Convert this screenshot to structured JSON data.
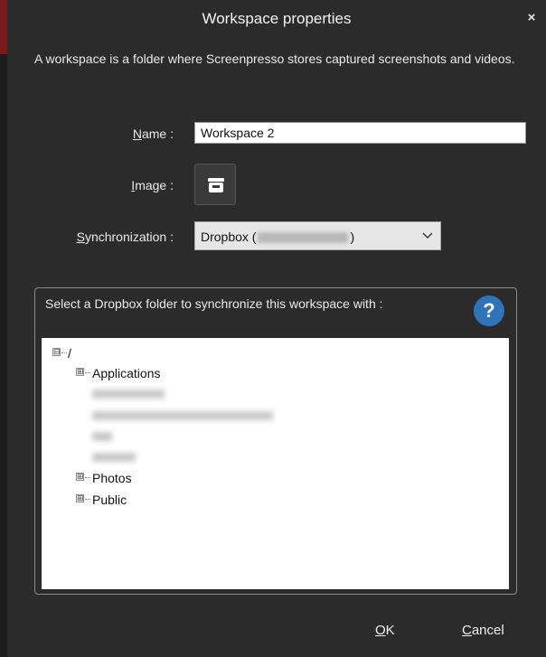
{
  "window": {
    "title": "Workspace properties",
    "close_glyph": "×"
  },
  "description": "A workspace is a folder where Screenpresso stores captured screenshots and videos.",
  "form": {
    "name_label": {
      "mnemonic": "N",
      "rest": "ame :"
    },
    "name_value": "Workspace 2",
    "image_label": {
      "mnemonic": "I",
      "rest": "mage :"
    },
    "image_icon": "tray-icon",
    "sync_label": {
      "mnemonic": "S",
      "rest": "ynchronization :"
    },
    "sync_value_prefix": "Dropbox (",
    "sync_value_suffix": ")"
  },
  "dropbox_group": {
    "label": "Select a Dropbox folder to synchronize this workspace with :",
    "help_glyph": "?",
    "help_color": "#2f74b8",
    "tree": {
      "root": {
        "label": "/",
        "expander": "⊟"
      },
      "children": [
        {
          "label": "Applications",
          "expander": "⊞"
        },
        {
          "label": "Photos",
          "expander": "⊞"
        },
        {
          "label": "Public",
          "expander": "⊞"
        }
      ]
    }
  },
  "footer": {
    "ok": {
      "mnemonic": "O",
      "rest": "K"
    },
    "cancel": {
      "mnemonic": "C",
      "rest": "ancel"
    }
  }
}
